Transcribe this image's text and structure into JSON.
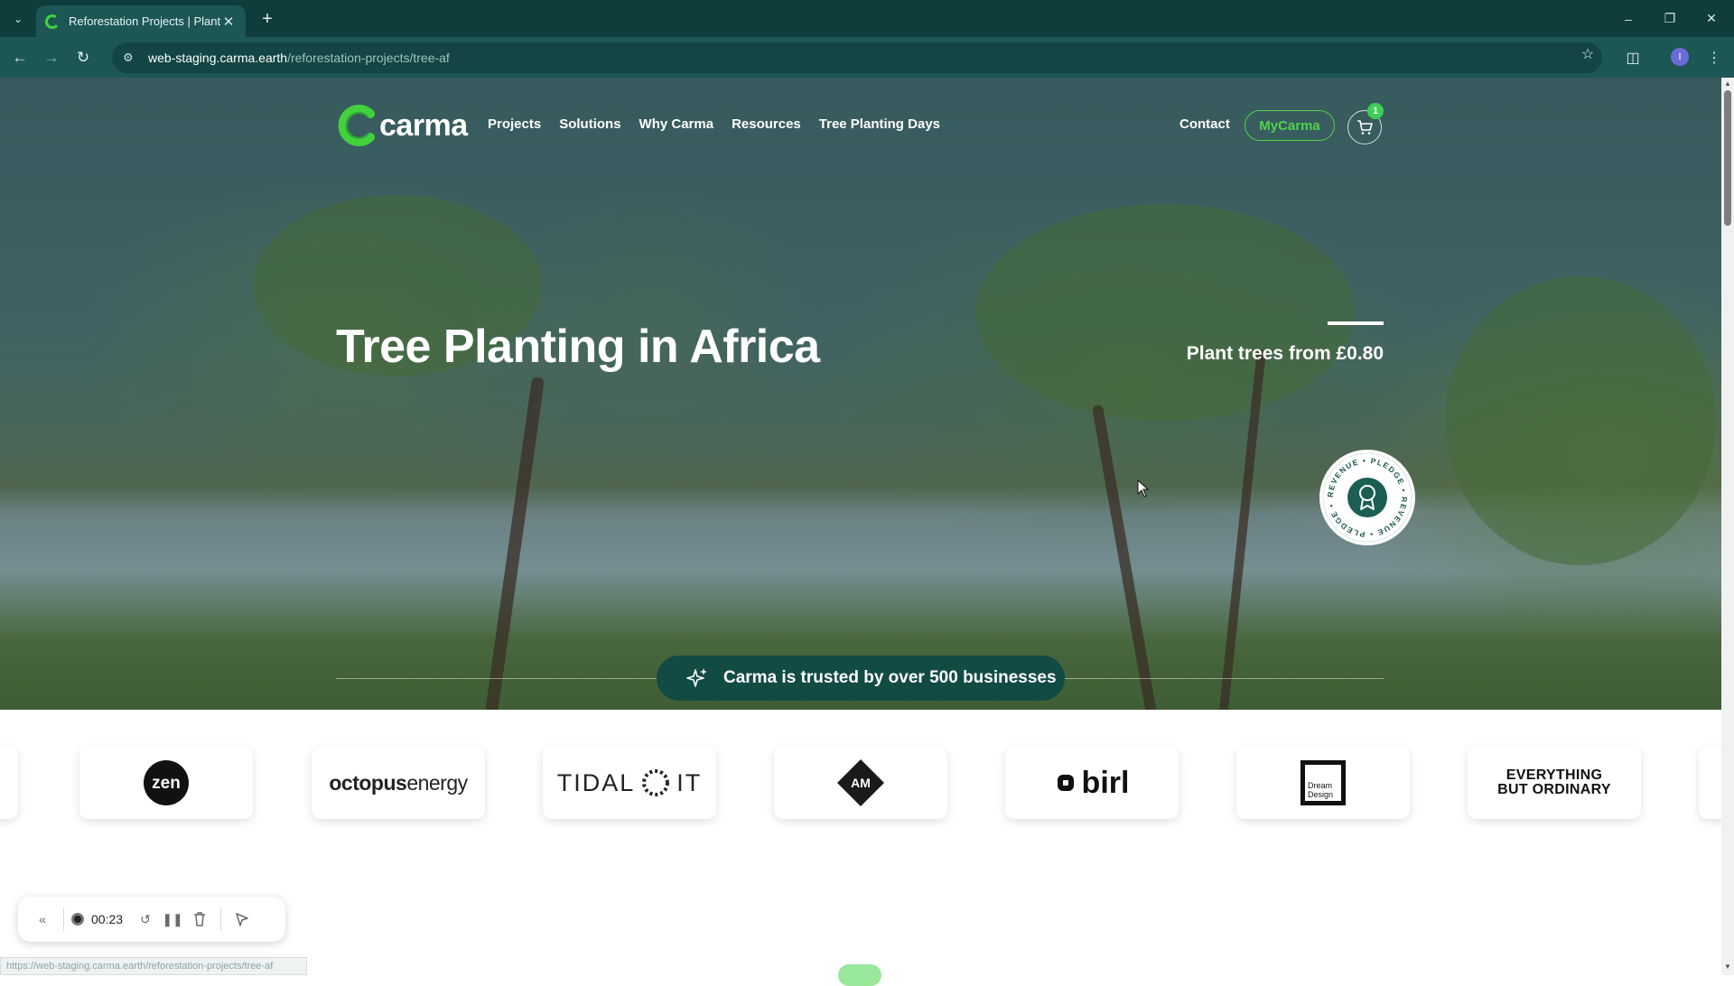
{
  "browser": {
    "tab_title": "Reforestation Projects | Plant Tr",
    "url_host": "web-staging.carma.earth",
    "url_path": "/reforestation-projects/tree-af",
    "profile_initial": "I",
    "status_url": "https://web-staging.carma.earth/reforestation-projects/tree-af"
  },
  "nav": {
    "logo_text": "carma",
    "links": [
      "Projects",
      "Solutions",
      "Why Carma",
      "Resources",
      "Tree Planting Days"
    ],
    "contact": "Contact",
    "mycarma": "MyCarma",
    "cart_count": "1"
  },
  "hero": {
    "title": "Tree Planting in Africa",
    "price_text": "Plant trees from £0.80",
    "pledge_text": "REVENUE • PLEDGE • REVENUE • PLEDGE •"
  },
  "trusted": {
    "text": "Carma is trusted by over 500 businesses"
  },
  "logos": [
    {
      "name": "zen",
      "label": "zen"
    },
    {
      "name": "octopus-energy",
      "label_a": "octopus",
      "label_b": "energy"
    },
    {
      "name": "tidal-it",
      "label_a": "TIDAL",
      "label_b": "IT"
    },
    {
      "name": "am",
      "label": "AM"
    },
    {
      "name": "birl",
      "label": "birl"
    },
    {
      "name": "dream-design",
      "label_a": "Dream",
      "label_b": "Design"
    },
    {
      "name": "everything-but-ordinary",
      "label_a": "EVERYTHING",
      "label_b": "BUT ORDINARY"
    }
  ],
  "recorder": {
    "time": "00:23"
  },
  "colors": {
    "chrome_dark": "#0f3d3c",
    "chrome_toolbar": "#1c5756",
    "brand_green": "#4fd34a",
    "trusted_bg": "#114b44"
  }
}
